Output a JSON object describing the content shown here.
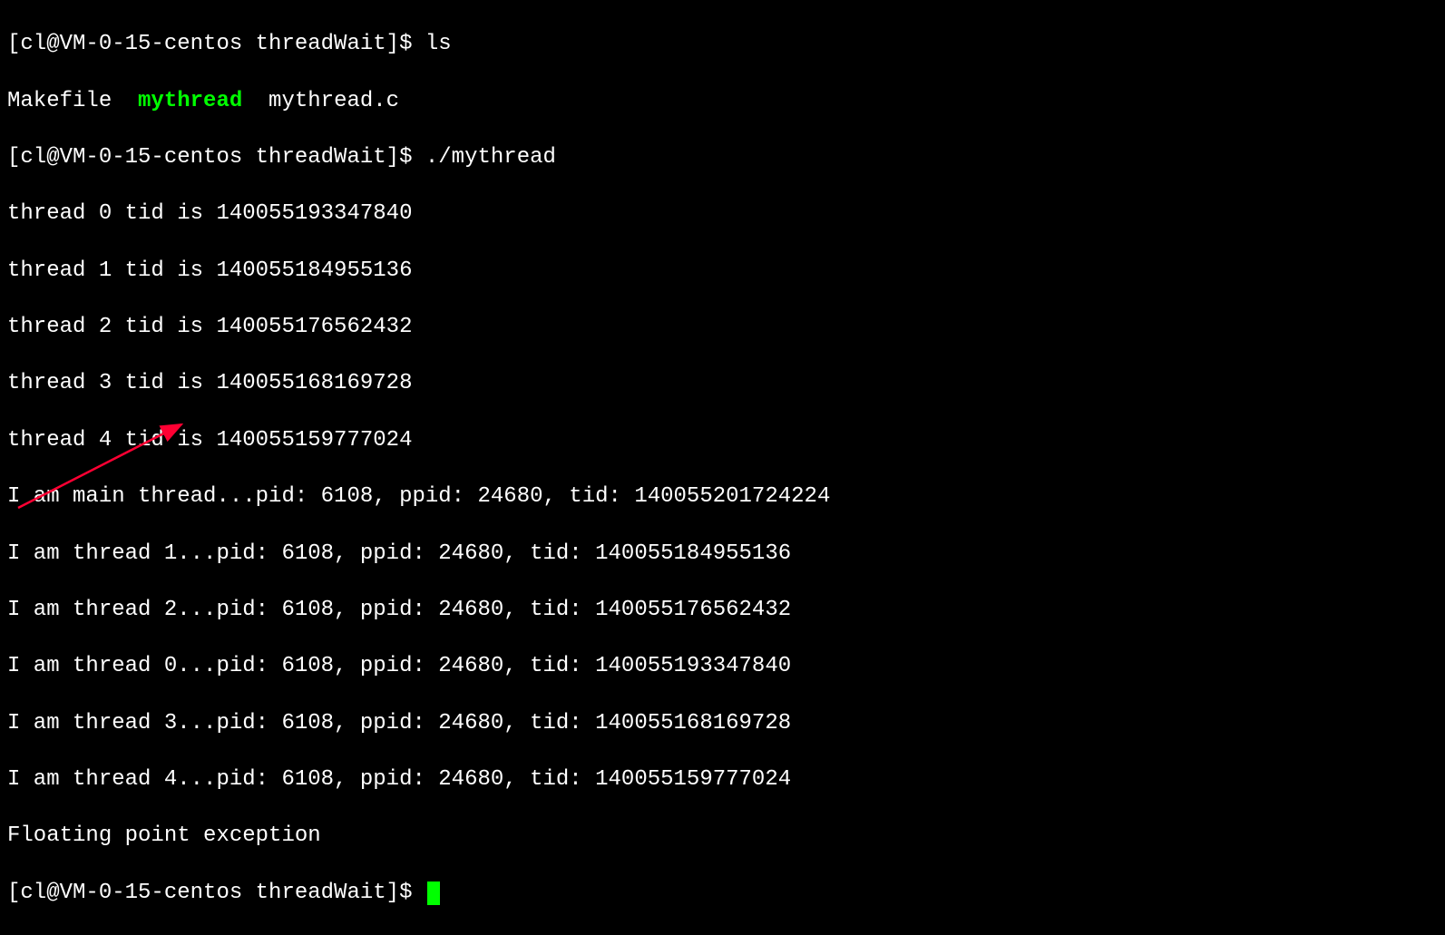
{
  "prompt1": "[cl@VM-0-15-centos threadWait]$ ",
  "cmd1": "ls",
  "ls_output": {
    "file1": "Makefile  ",
    "file2_exec": "mythread",
    "file3": "  mythread.c"
  },
  "prompt2": "[cl@VM-0-15-centos threadWait]$ ",
  "cmd2": "./mythread",
  "threads_tid": [
    "thread 0 tid is 140055193347840",
    "thread 1 tid is 140055184955136",
    "thread 2 tid is 140055176562432",
    "thread 3 tid is 140055168169728",
    "thread 4 tid is 140055159777024"
  ],
  "main_thread": "I am main thread...pid: 6108, ppid: 24680, tid: 140055201724224",
  "iam_threads": [
    "I am thread 1...pid: 6108, ppid: 24680, tid: 140055184955136",
    "I am thread 2...pid: 6108, ppid: 24680, tid: 140055176562432",
    "I am thread 0...pid: 6108, ppid: 24680, tid: 140055193347840",
    "I am thread 3...pid: 6108, ppid: 24680, tid: 140055168169728",
    "I am thread 4...pid: 6108, ppid: 24680, tid: 140055159777024"
  ],
  "error": "Floating point exception",
  "prompt3": "[cl@VM-0-15-centos threadWait]$ "
}
